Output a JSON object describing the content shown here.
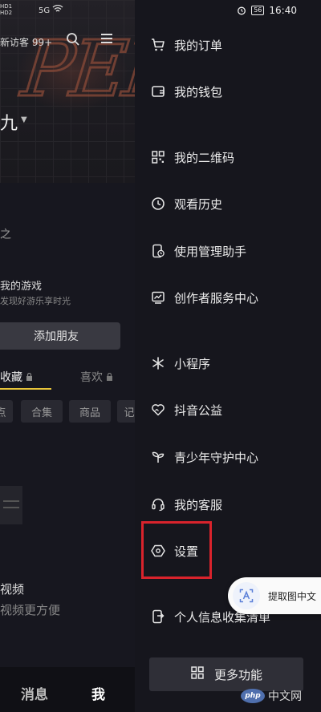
{
  "status_bar": {
    "left_icons": [
      "HD1",
      "HD2",
      "5G",
      "wifi-icon"
    ],
    "battery": "56",
    "time": "16:40"
  },
  "profile": {
    "visitor_text": "新访客 99+",
    "name_fragment": "九",
    "text_1": "之",
    "text_2": "我的游戏",
    "text_3": "发现好游乐享时光",
    "add_friend_label": "添加朋友",
    "tab_favorites": "收藏",
    "tab_likes": "喜欢",
    "chips": [
      "点",
      "合集",
      "商品",
      "记"
    ],
    "text_4": "视频",
    "text_5": "视频更方便",
    "nav_messages": "消息",
    "nav_me": "我"
  },
  "drawer": {
    "items": [
      {
        "label": "我的订单",
        "icon": "cart-icon"
      },
      {
        "label": "我的钱包",
        "icon": "wallet-icon"
      },
      {
        "label": "我的二维码",
        "icon": "qrcode-icon"
      },
      {
        "label": "观看历史",
        "icon": "clock-icon"
      },
      {
        "label": "使用管理助手",
        "icon": "phone-clock-icon"
      },
      {
        "label": "创作者服务中心",
        "icon": "chart-icon"
      },
      {
        "label": "小程序",
        "icon": "asterisk-icon"
      },
      {
        "label": "抖音公益",
        "icon": "heart-icon"
      },
      {
        "label": "青少年守护中心",
        "icon": "sprout-icon"
      },
      {
        "label": "我的客服",
        "icon": "headset-icon"
      },
      {
        "label": "设置",
        "icon": "hexagon-settings-icon"
      },
      {
        "label": "个人信息收集清单",
        "icon": "phone-arrow-icon"
      }
    ],
    "more_label": "更多功能",
    "highlight_color": "#d9232c"
  },
  "ocr_pill": {
    "label": "提取图中文"
  },
  "watermark": {
    "logo": "php",
    "text": "中文网"
  }
}
